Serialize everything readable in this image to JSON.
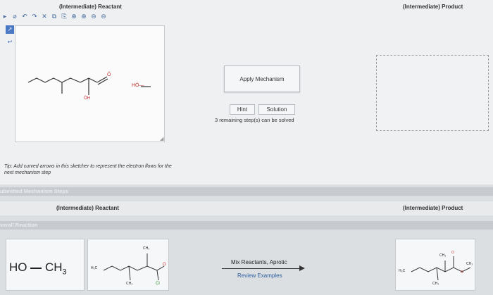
{
  "left_title": "(Intermediate) Reactant",
  "right_title": "(Intermediate) Product",
  "apply_button": "Apply Mechanism",
  "hint_button": "Hint",
  "solution_button": "Solution",
  "remaining_text": "3 remaining step(s) can be solved",
  "tip_text": "Tip: Add curved arrows in this sketcher to represent the electron flows for the next mechanism step",
  "submitted_section": "ubmitted Mechanism Steps",
  "submitted_left": "(Intermediate) Reactant",
  "submitted_right": "(Intermediate) Product",
  "overall_section": "verall Reaction",
  "reactant_formula_ho": "HO",
  "reactant_formula_ch": "CH",
  "reactant_formula_sub": "3",
  "mix_label": "Mix Reactants, Aprotic",
  "review_label": "Review Examples",
  "molecule_labels": {
    "hydroxide": "HÖ—",
    "carbonyl_o": "Ö",
    "hydroxyl": "ÖH",
    "h3c": "H₃C",
    "ch3": "CH₃",
    "cl": "Cl",
    "o": "O"
  },
  "colors": {
    "accent": "#4a78c4",
    "link": "#2c5fa0",
    "section_bar": "#c7cbcf"
  }
}
